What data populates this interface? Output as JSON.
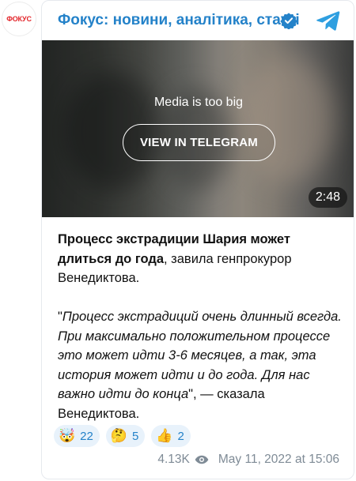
{
  "avatar": {
    "label": "ФОКУС"
  },
  "channel": {
    "title": "Фокус: новини, аналітика, статті"
  },
  "icons": {
    "verified": "verified-badge-icon",
    "telegram": "telegram-icon",
    "views": "eye-icon"
  },
  "colors": {
    "accent": "#2482c9",
    "reaction_bg": "#e8f2fb",
    "logo": "#e3262b"
  },
  "media": {
    "message": "Media is too big",
    "button": "VIEW IN TELEGRAM",
    "duration": "2:48"
  },
  "post": {
    "lead_bold": "Процесс экстрадиции Шария может длиться до года",
    "lead_rest": ", завила генпрокурор Венедиктова.",
    "quote_open": "\"",
    "quote_italic": "Процесс экстрадиций очень длинный всегда. При максимально положительном процессе это может идти 3-6 месяцев, а так, эта история может идти и до года. Для нас важно идти до конца",
    "quote_close": "\", — сказала Венедиктова."
  },
  "reactions": [
    {
      "emoji": "🤯",
      "count": "22"
    },
    {
      "emoji": "🤔",
      "count": "5"
    },
    {
      "emoji": "👍",
      "count": "2"
    }
  ],
  "footer": {
    "views": "4.13K",
    "date": "May 11, 2022 at 15:06"
  }
}
